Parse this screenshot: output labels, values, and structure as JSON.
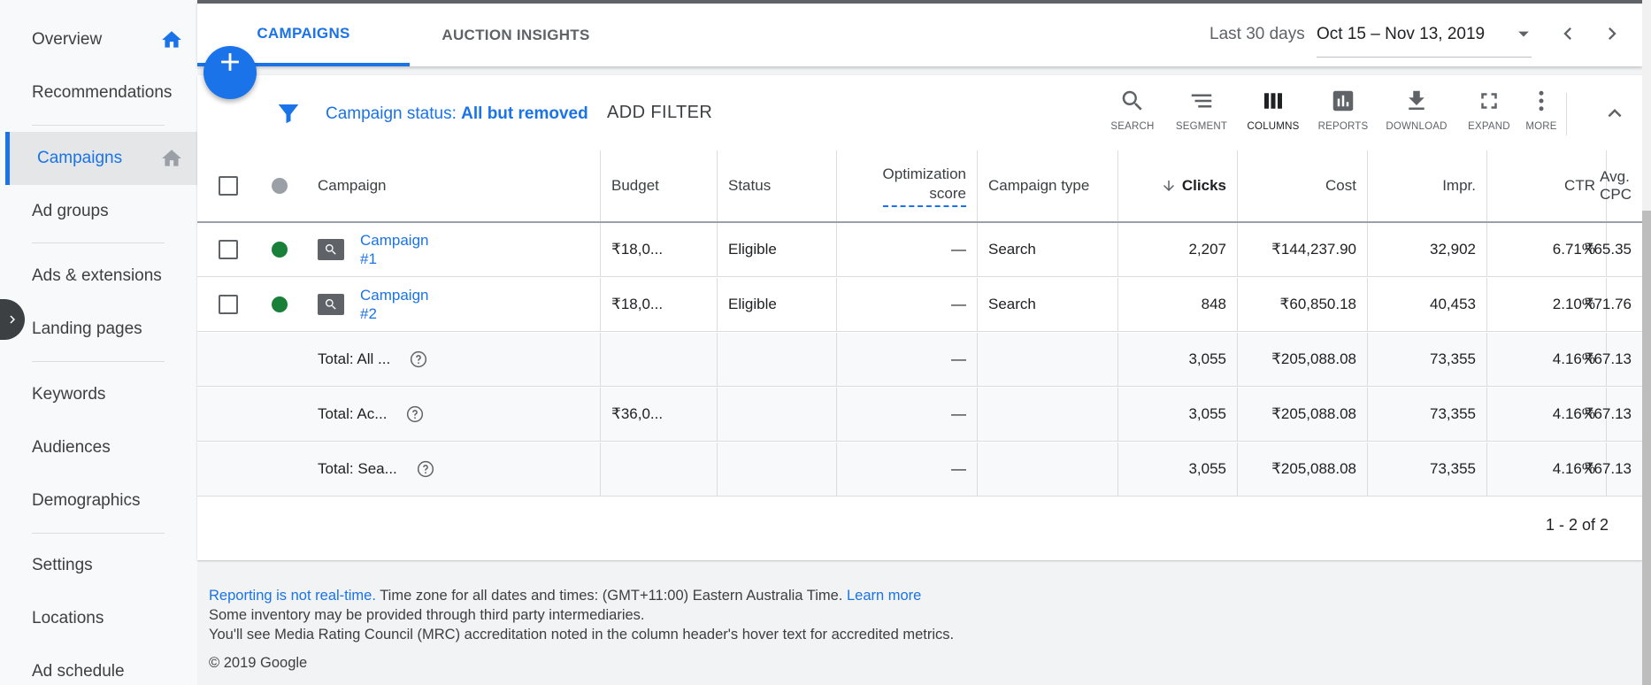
{
  "sidebar": {
    "items": [
      {
        "label": "Overview",
        "icon": "home-icon"
      },
      {
        "label": "Recommendations"
      },
      {
        "label": "Campaigns",
        "icon": "home-outline-icon",
        "active": true
      },
      {
        "label": "Ad groups"
      },
      {
        "label": "Ads & extensions"
      },
      {
        "label": "Landing pages"
      },
      {
        "label": "Keywords"
      },
      {
        "label": "Audiences"
      },
      {
        "label": "Demographics"
      },
      {
        "label": "Settings"
      },
      {
        "label": "Locations"
      },
      {
        "label": "Ad schedule"
      }
    ]
  },
  "header": {
    "tabs": [
      {
        "label": "CAMPAIGNS",
        "active": true
      },
      {
        "label": "AUCTION INSIGHTS"
      }
    ],
    "date_label": "Last 30 days",
    "date_range": "Oct 15 – Nov 13, 2019"
  },
  "filter": {
    "prefix": "Campaign status: ",
    "value": "All but removed",
    "add_filter": "ADD FILTER"
  },
  "toolbar": {
    "search": "SEARCH",
    "segment": "SEGMENT",
    "columns": "COLUMNS",
    "reports": "REPORTS",
    "download": "DOWNLOAD",
    "expand": "EXPAND",
    "more": "MORE"
  },
  "table": {
    "headers": {
      "campaign": "Campaign",
      "budget": "Budget",
      "status": "Status",
      "opt_line1": "Optimization",
      "opt_line2": "score",
      "campaign_type": "Campaign type",
      "clicks": "Clicks",
      "cost": "Cost",
      "impr": "Impr.",
      "ctr": "CTR",
      "avg_cpc": "Avg. CPC"
    },
    "rows": [
      {
        "name_line1": "Campaign",
        "name_line2": "#1",
        "budget": "₹18,0...",
        "status": "Eligible",
        "opt": "—",
        "type": "Search",
        "clicks": "2,207",
        "cost": "₹144,237.90",
        "impr": "32,902",
        "ctr": "6.71%",
        "avg_cpc": "₹65.35"
      },
      {
        "name_line1": "Campaign",
        "name_line2": "#2",
        "budget": "₹18,0...",
        "status": "Eligible",
        "opt": "—",
        "type": "Search",
        "clicks": "848",
        "cost": "₹60,850.18",
        "impr": "40,453",
        "ctr": "2.10%",
        "avg_cpc": "₹71.76"
      }
    ],
    "totals": [
      {
        "label": "Total: All ...",
        "budget": "",
        "opt": "—",
        "clicks": "3,055",
        "cost": "₹205,088.08",
        "impr": "73,355",
        "ctr": "4.16%",
        "avg_cpc": "₹67.13"
      },
      {
        "label": "Total: Ac...",
        "budget": "₹36,0...",
        "opt": "—",
        "clicks": "3,055",
        "cost": "₹205,088.08",
        "impr": "73,355",
        "ctr": "4.16%",
        "avg_cpc": "₹67.13"
      },
      {
        "label": "Total: Sea...",
        "budget": "",
        "opt": "—",
        "clicks": "3,055",
        "cost": "₹205,088.08",
        "impr": "73,355",
        "ctr": "4.16%",
        "avg_cpc": "₹67.13"
      }
    ],
    "pagination": "1 - 2 of 2"
  },
  "footer": {
    "realtime_link": "Reporting is not real-time.",
    "timezone_text": " Time zone for all dates and times: (GMT+11:00) Eastern Australia Time. ",
    "learn_more": "Learn more",
    "line2": "Some inventory may be provided through third party intermediaries.",
    "line3": "You'll see Media Rating Council (MRC) accreditation noted in the column header's hover text for accredited metrics.",
    "copyright": "© 2019 Google"
  },
  "colors": {
    "accent": "#1a73e8",
    "status_enabled": "#188038",
    "status_unknown": "#9aa0a6"
  }
}
